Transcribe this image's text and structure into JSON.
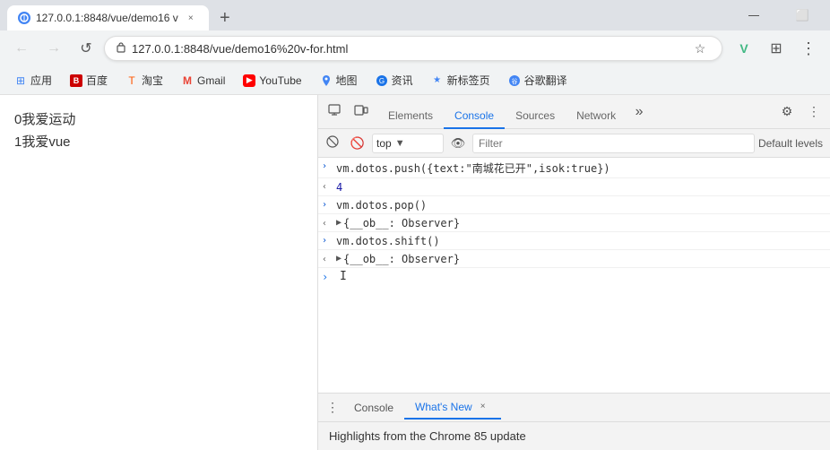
{
  "browser": {
    "title_bar": {
      "tab_label": "127.0.0.1:8848/vue/demo16 v",
      "close_label": "×",
      "new_tab_label": "+"
    },
    "address_bar": {
      "url": "127.0.0.1:8848/vue/demo16%20v-for.html",
      "lock_icon": "🔒"
    },
    "bookmarks": [
      {
        "label": "应用",
        "favicon": "⊞",
        "type": "apps"
      },
      {
        "label": "百度",
        "favicon": "B",
        "type": "baidu"
      },
      {
        "label": "淘宝",
        "favicon": "T",
        "type": "taobao"
      },
      {
        "label": "Gmail",
        "favicon": "M",
        "type": "gmail"
      },
      {
        "label": "YouTube",
        "favicon": "▶",
        "type": "youtube"
      },
      {
        "label": "地图",
        "favicon": "P",
        "type": "maps"
      },
      {
        "label": "资讯",
        "favicon": "N",
        "type": "news"
      },
      {
        "label": "新标签页",
        "favicon": "★",
        "type": "newtab"
      },
      {
        "label": "谷歌翻译",
        "favicon": "T",
        "type": "translate"
      }
    ]
  },
  "page": {
    "items": [
      {
        "index": "0",
        "text": "我爱运动"
      },
      {
        "index": "1",
        "text": "我爱vue"
      }
    ]
  },
  "devtools": {
    "tabs": [
      "Elements",
      "Console",
      "Sources",
      "Network"
    ],
    "active_tab": "Console",
    "more_label": "»",
    "console_context": "top",
    "filter_placeholder": "Filter",
    "default_levels": "Default levels",
    "console_entries": [
      {
        "type": "input",
        "arrow": ">",
        "text": "vm.dotos.push({text:\"南城花已开\",isok:true})"
      },
      {
        "type": "result",
        "arrow": "<",
        "text": "4"
      },
      {
        "type": "input",
        "arrow": ">",
        "text": "vm.dotos.pop()"
      },
      {
        "type": "expand-result",
        "arrow": "<",
        "expand": "▶",
        "text": "{__ob__: Observer}"
      },
      {
        "type": "input",
        "arrow": ">",
        "text": "vm.dotos.shift()"
      },
      {
        "type": "expand-result",
        "arrow": "<",
        "expand": "▶",
        "text": "{__ob__: Observer}"
      }
    ],
    "bottom_tabs": [
      {
        "label": "Console",
        "closeable": false
      },
      {
        "label": "What's New",
        "closeable": true
      }
    ],
    "bottom_active": "What's New",
    "bottom_content": "Highlights from the Chrome 85 update"
  },
  "icons": {
    "back": "←",
    "forward": "→",
    "reload": "↺",
    "star": "☆",
    "vue": "V",
    "extensions": "⊞",
    "inspect": "⬚",
    "device": "☐",
    "close_devtools": "✕",
    "console_clear": "🚫",
    "eye": "👁",
    "more_vert": "⋮",
    "cursor": "I"
  }
}
